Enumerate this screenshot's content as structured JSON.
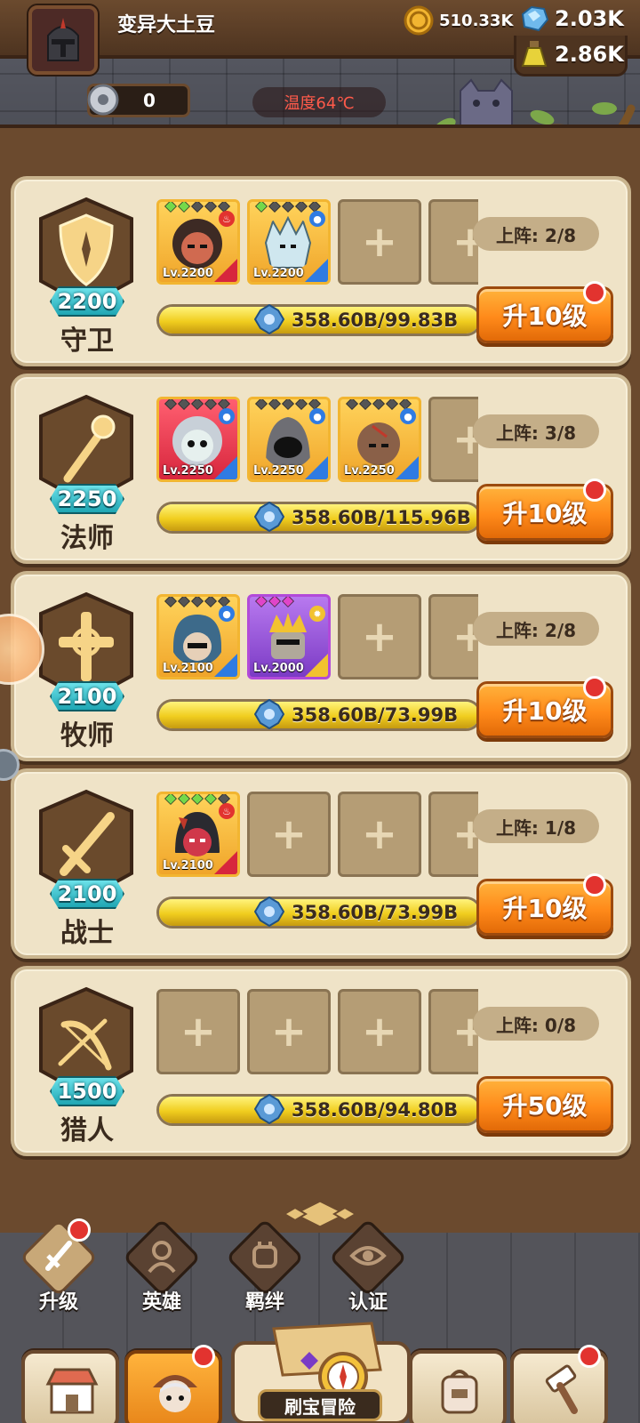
{
  "header": {
    "player_name": "变异大土豆",
    "coins": "510.33K",
    "gems": "2.03K",
    "potions": "2.86K",
    "gear_count": "0",
    "temperature": "温度64℃"
  },
  "classes": [
    {
      "name": "守卫",
      "level": "2200",
      "deploy": "上阵: 2/8",
      "progress_text": "358.60B/99.83B",
      "progress": 1.0,
      "button": "升10级",
      "heroes": [
        {
          "lv": "Lv.2200",
          "rarity": "gold"
        },
        {
          "lv": "Lv.2200",
          "rarity": "gold"
        }
      ]
    },
    {
      "name": "法师",
      "level": "2250",
      "deploy": "上阵: 3/8",
      "progress_text": "358.60B/115.96B",
      "progress": 1.0,
      "button": "升10级",
      "heroes": [
        {
          "lv": "Lv.2250",
          "rarity": "gold"
        },
        {
          "lv": "Lv.2250",
          "rarity": "gold"
        },
        {
          "lv": "Lv.2250",
          "rarity": "gold"
        }
      ]
    },
    {
      "name": "牧师",
      "level": "2100",
      "deploy": "上阵: 2/8",
      "progress_text": "358.60B/73.99B",
      "progress": 1.0,
      "button": "升10级",
      "heroes": [
        {
          "lv": "Lv.2100",
          "rarity": "gold"
        },
        {
          "lv": "Lv.2000",
          "rarity": "purple"
        }
      ]
    },
    {
      "name": "战士",
      "level": "2100",
      "deploy": "上阵: 1/8",
      "progress_text": "358.60B/73.99B",
      "progress": 1.0,
      "button": "升10级",
      "heroes": [
        {
          "lv": "Lv.2100",
          "rarity": "gold"
        }
      ]
    },
    {
      "name": "猎人",
      "level": "1500",
      "deploy": "上阵: 0/8",
      "progress_text": "358.60B/94.80B",
      "progress": 1.0,
      "button": "升50级",
      "heroes": []
    }
  ],
  "sub_tabs": [
    {
      "label": "升级",
      "icon": "sword-upgrade-icon"
    },
    {
      "label": "英雄",
      "icon": "hero-icon"
    },
    {
      "label": "羁绊",
      "icon": "handshake-icon"
    },
    {
      "label": "认证",
      "icon": "eye-icon"
    }
  ],
  "nav": {
    "adventure_label": "刷宝冒险"
  },
  "colors": {
    "accent_orange": "#ff8a1a",
    "level_teal": "#1fa6b3",
    "progress_yellow": "#f0cd1e",
    "card_bg": "#efe3c7",
    "notification_red": "#e2332f"
  }
}
